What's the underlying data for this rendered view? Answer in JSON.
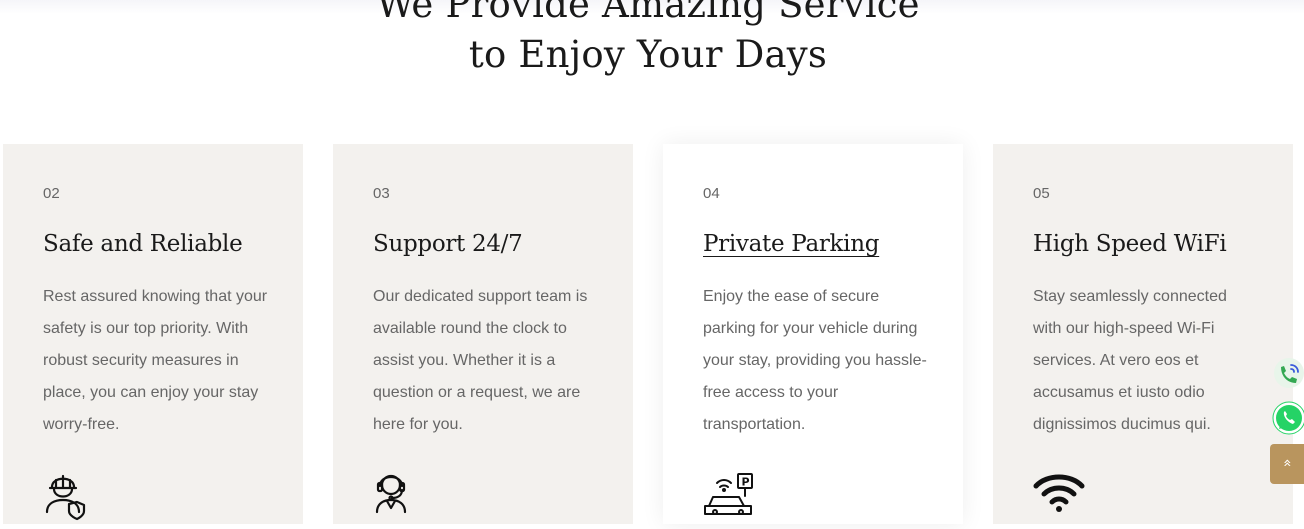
{
  "section": {
    "heading_line1": "We Provide Amazing Service",
    "heading_line2": "to Enjoy Your Days"
  },
  "cards": [
    {
      "number": "02",
      "title": "Safe and Reliable",
      "text": "Rest assured knowing that your safety is our top priority. With robust security measures in place, you can enjoy your stay worry-free.",
      "icon": "security-guard-icon"
    },
    {
      "number": "03",
      "title": "Support 24/7",
      "text": "Our dedicated support team is available round the clock to assist you. Whether it is a question or a request, we are here for you.",
      "icon": "headset-support-icon"
    },
    {
      "number": "04",
      "title": "Private Parking",
      "text": "Enjoy the ease of secure parking for your vehicle during your stay, providing you hassle-free access to your transportation.",
      "icon": "parking-car-icon"
    },
    {
      "number": "05",
      "title": "High Speed WiFi",
      "text": "Stay seamlessly connected with our high-speed Wi-Fi services. At vero eos et accusamus et iusto odio dignissimos ducimus qui.",
      "icon": "wifi-icon"
    }
  ],
  "floating_buttons": {
    "call_icon": "phone-call-icon",
    "whatsapp_icon": "whatsapp-icon",
    "scroll_top_icon": "chevron-double-up-icon",
    "scroll_top_glyph": "»"
  },
  "colors": {
    "card_bg": "#f3f1ee",
    "card_active_bg": "#ffffff",
    "accent": "#b9955e",
    "whatsapp_green": "#25d366",
    "heading_text": "#1a1a1a",
    "body_text": "#666666"
  }
}
